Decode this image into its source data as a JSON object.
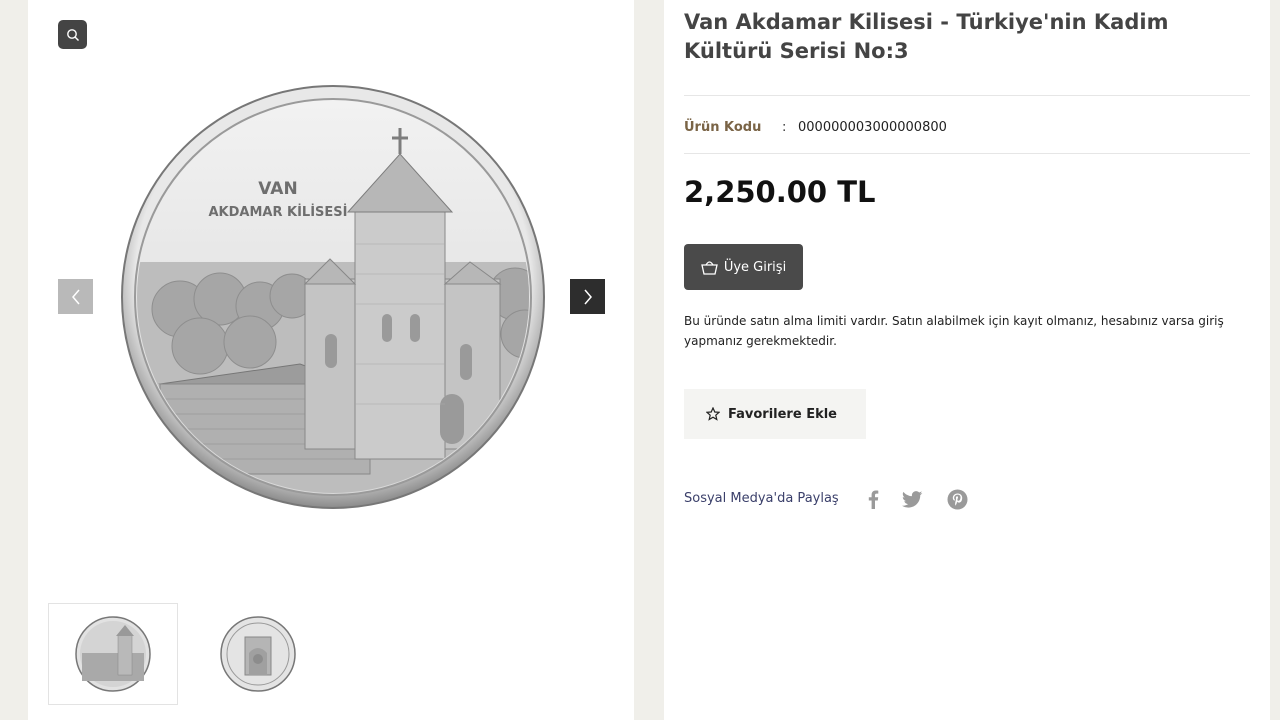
{
  "product": {
    "title": "Van Akdamar Kilisesi - Türkiye'nin Kadim Kültürü Serisi No:3",
    "code_label": "Ürün Kodu",
    "code_separator": ":",
    "code_value": "000000003000000800",
    "price": "2,250.00 TL",
    "login_button": "Üye Girişi",
    "limit_notice": "Bu üründe satın alma limiti vardır. Satın alabilmek için kayıt olmanız, hesabınız varsa giriş yapmanız gerekmektedir.",
    "favorite_button": "Favorilere Ekle",
    "share_label": "Sosyal Medya'da Paylaş"
  },
  "gallery": {
    "coin_text_line1": "VAN",
    "coin_text_line2": "AKDAMAR KİLİSESİ",
    "icons": [
      "search-icon",
      "chevron-left-icon",
      "chevron-right-icon"
    ],
    "thumbnails": [
      "coin-front",
      "coin-back"
    ]
  },
  "social_icons": [
    "facebook-icon",
    "twitter-icon",
    "pinterest-icon"
  ],
  "colors": {
    "page_bg": "#f0efea",
    "button_dark": "#4a4a4a",
    "code_label": "#7a6446",
    "share_label": "#3a3f6a"
  }
}
